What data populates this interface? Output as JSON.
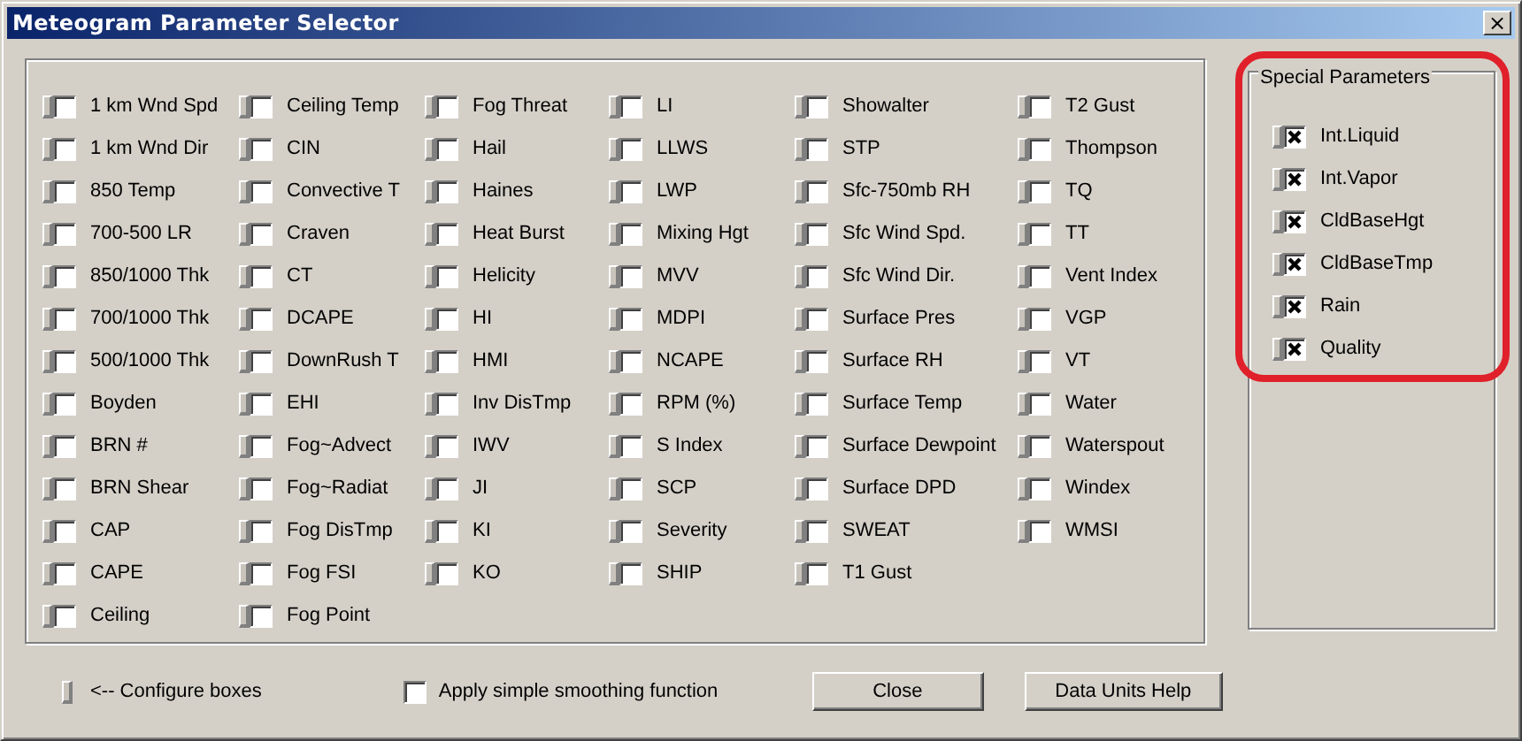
{
  "window": {
    "title": "Meteogram Parameter Selector",
    "close_symbol": "×"
  },
  "parameter_columns": [
    {
      "items": [
        {
          "label": "1 km Wnd Spd",
          "checked": false
        },
        {
          "label": "1 km Wnd Dir",
          "checked": false
        },
        {
          "label": "850 Temp",
          "checked": false
        },
        {
          "label": "700-500 LR",
          "checked": false
        },
        {
          "label": "850/1000 Thk",
          "checked": false
        },
        {
          "label": "700/1000 Thk",
          "checked": false
        },
        {
          "label": "500/1000 Thk",
          "checked": false
        },
        {
          "label": "Boyden",
          "checked": false
        },
        {
          "label": "BRN #",
          "checked": false
        },
        {
          "label": "BRN Shear",
          "checked": false
        },
        {
          "label": "CAP",
          "checked": false
        },
        {
          "label": "CAPE",
          "checked": false
        },
        {
          "label": "Ceiling",
          "checked": false
        }
      ]
    },
    {
      "items": [
        {
          "label": "Ceiling Temp",
          "checked": false
        },
        {
          "label": "CIN",
          "checked": false
        },
        {
          "label": "Convective T",
          "checked": false
        },
        {
          "label": "Craven",
          "checked": false
        },
        {
          "label": "CT",
          "checked": false
        },
        {
          "label": "DCAPE",
          "checked": false
        },
        {
          "label": "DownRush T",
          "checked": false
        },
        {
          "label": "EHI",
          "checked": false
        },
        {
          "label": "Fog~Advect",
          "checked": false
        },
        {
          "label": "Fog~Radiat",
          "checked": false
        },
        {
          "label": "Fog DisTmp",
          "checked": false
        },
        {
          "label": "Fog FSI",
          "checked": false
        },
        {
          "label": "Fog Point",
          "checked": false
        }
      ]
    },
    {
      "items": [
        {
          "label": "Fog Threat",
          "checked": false
        },
        {
          "label": "Hail",
          "checked": false
        },
        {
          "label": "Haines",
          "checked": false
        },
        {
          "label": "Heat Burst",
          "checked": false
        },
        {
          "label": "Helicity",
          "checked": false
        },
        {
          "label": "HI",
          "checked": false
        },
        {
          "label": "HMI",
          "checked": false
        },
        {
          "label": "Inv DisTmp",
          "checked": false
        },
        {
          "label": "IWV",
          "checked": false
        },
        {
          "label": "JI",
          "checked": false
        },
        {
          "label": "KI",
          "checked": false
        },
        {
          "label": "KO",
          "checked": false
        }
      ]
    },
    {
      "items": [
        {
          "label": "LI",
          "checked": false
        },
        {
          "label": "LLWS",
          "checked": false
        },
        {
          "label": "LWP",
          "checked": false
        },
        {
          "label": "Mixing Hgt",
          "checked": false
        },
        {
          "label": "MVV",
          "checked": false
        },
        {
          "label": "MDPI",
          "checked": false
        },
        {
          "label": "NCAPE",
          "checked": false
        },
        {
          "label": "RPM (%)",
          "checked": false
        },
        {
          "label": "S Index",
          "checked": false
        },
        {
          "label": "SCP",
          "checked": false
        },
        {
          "label": "Severity",
          "checked": false
        },
        {
          "label": "SHIP",
          "checked": false
        }
      ]
    },
    {
      "items": [
        {
          "label": "Showalter",
          "checked": false
        },
        {
          "label": "STP",
          "checked": false
        },
        {
          "label": "Sfc-750mb RH",
          "checked": false
        },
        {
          "label": "Sfc Wind Spd.",
          "checked": false
        },
        {
          "label": "Sfc Wind Dir.",
          "checked": false
        },
        {
          "label": "Surface Pres",
          "checked": false
        },
        {
          "label": "Surface RH",
          "checked": false
        },
        {
          "label": "Surface Temp",
          "checked": false
        },
        {
          "label": "Surface Dewpoint",
          "checked": false
        },
        {
          "label": "Surface DPD",
          "checked": false
        },
        {
          "label": "SWEAT",
          "checked": false
        },
        {
          "label": "T1 Gust",
          "checked": false
        }
      ]
    },
    {
      "items": [
        {
          "label": "T2 Gust",
          "checked": false
        },
        {
          "label": "Thompson",
          "checked": false
        },
        {
          "label": "TQ",
          "checked": false
        },
        {
          "label": "TT",
          "checked": false
        },
        {
          "label": "Vent Index",
          "checked": false
        },
        {
          "label": "VGP",
          "checked": false
        },
        {
          "label": "VT",
          "checked": false
        },
        {
          "label": "Water",
          "checked": false
        },
        {
          "label": "Waterspout",
          "checked": false
        },
        {
          "label": "Windex",
          "checked": false
        },
        {
          "label": "WMSI",
          "checked": false
        }
      ]
    }
  ],
  "special_parameters": {
    "title": "Special Parameters",
    "items": [
      {
        "label": "Int.Liquid",
        "checked": true
      },
      {
        "label": "Int.Vapor",
        "checked": true
      },
      {
        "label": "CldBaseHgt",
        "checked": true
      },
      {
        "label": "CldBaseTmp",
        "checked": true
      },
      {
        "label": "Rain",
        "checked": true
      },
      {
        "label": "Quality",
        "checked": true
      }
    ]
  },
  "configure": {
    "label": "<-- Configure boxes"
  },
  "smoothing": {
    "label": "Apply simple smoothing function",
    "checked": false
  },
  "buttons": [
    "Close",
    "Data Units Help"
  ]
}
